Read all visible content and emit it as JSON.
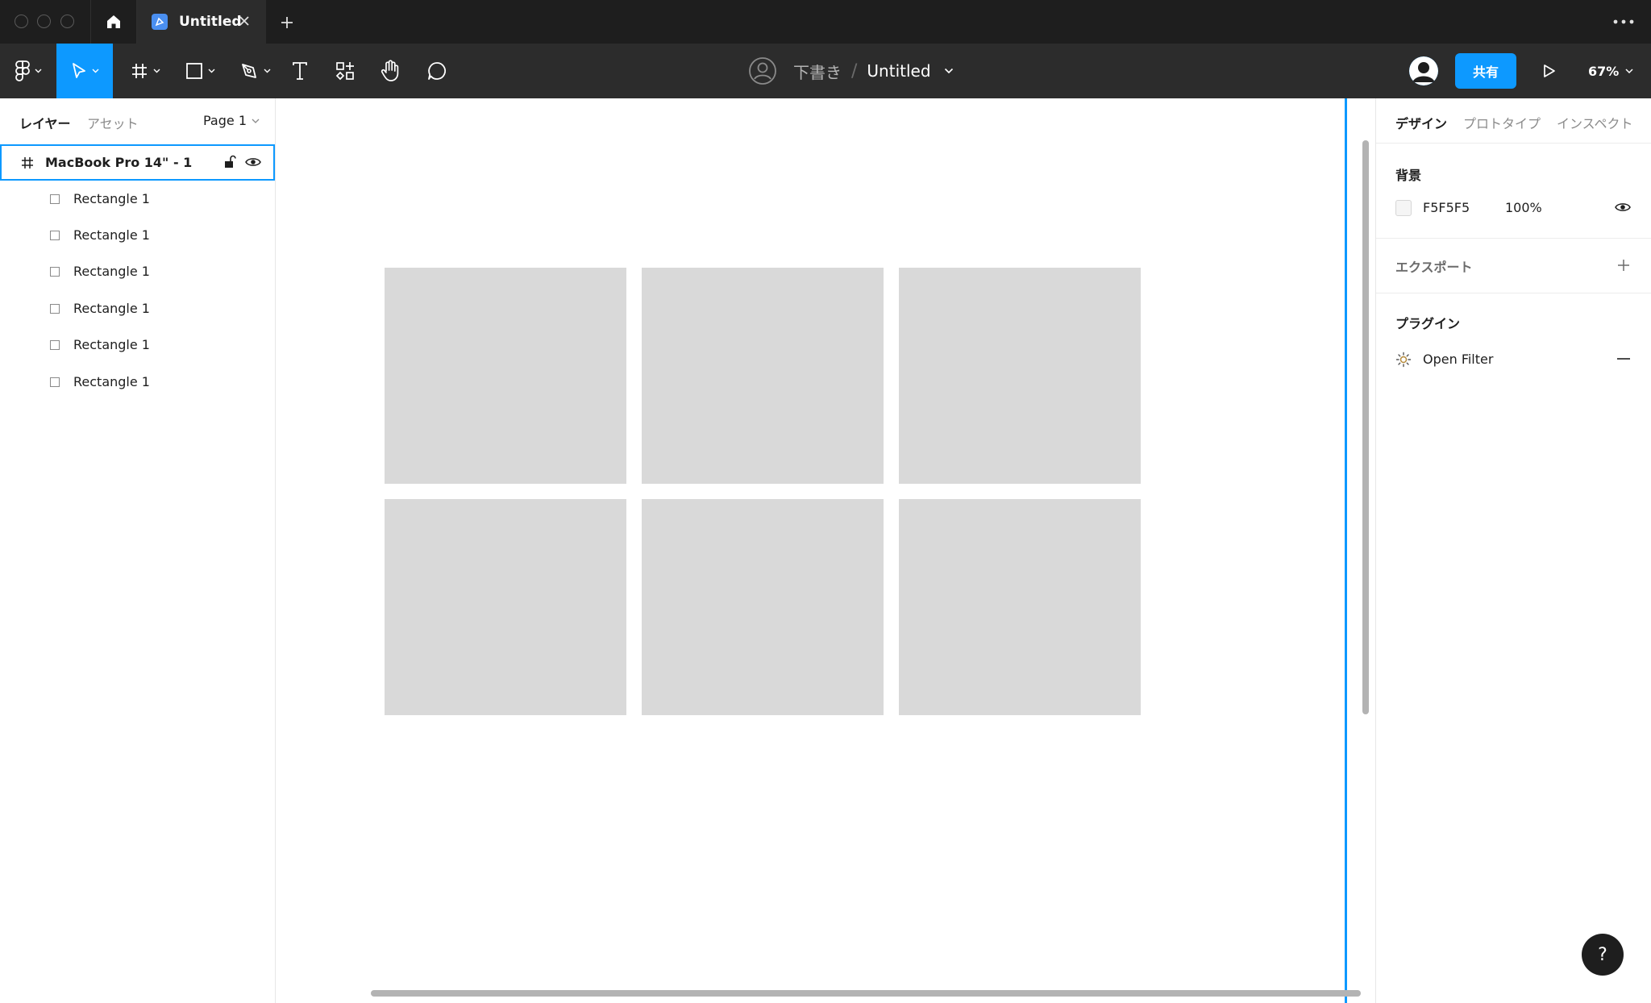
{
  "titlebar": {
    "tab_title": "Untitled"
  },
  "toolbar": {
    "breadcrumb_draft": "下書き",
    "breadcrumb_separator": "/",
    "breadcrumb_file": "Untitled",
    "share_label": "共有",
    "zoom": "67%"
  },
  "left_panel": {
    "tab_layers": "レイヤー",
    "tab_assets": "アセット",
    "page": "Page 1",
    "frame": {
      "name": "MacBook Pro 14\" - 1"
    },
    "layers": [
      {
        "name": "Rectangle 1"
      },
      {
        "name": "Rectangle 1"
      },
      {
        "name": "Rectangle 1"
      },
      {
        "name": "Rectangle 1"
      },
      {
        "name": "Rectangle 1"
      },
      {
        "name": "Rectangle 1"
      }
    ]
  },
  "right_panel": {
    "tabs": [
      "デザイン",
      "プロトタイプ",
      "インスペクト"
    ],
    "background": {
      "heading": "背景",
      "hex": "F5F5F5",
      "opacity": "100%",
      "swatch_color": "#F5F5F5"
    },
    "export": {
      "heading": "エクスポート"
    },
    "plugins": {
      "heading": "プラグイン",
      "items": [
        {
          "name": "Open Filter"
        }
      ]
    }
  },
  "canvas": {
    "rect_fill": "#D9D9D9"
  },
  "help": {
    "label": "?"
  },
  "colors": {
    "accent": "#0D99FF",
    "titlebar": "#1E1E1E",
    "toolbar": "#2C2C2C"
  }
}
